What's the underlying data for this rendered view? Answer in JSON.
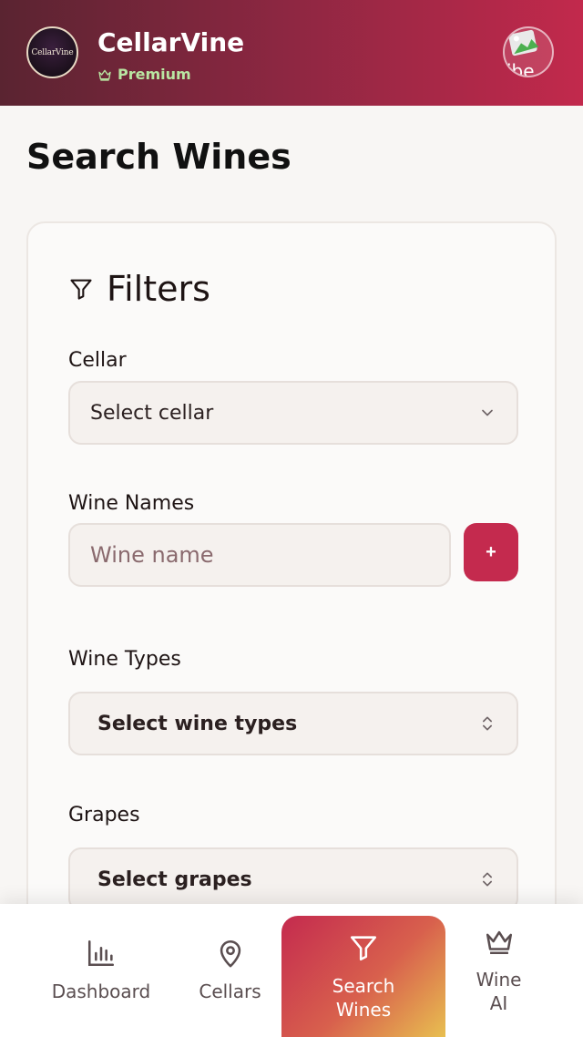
{
  "header": {
    "app_name": "CellarVine",
    "logo_text": "CellarVine",
    "plan_badge": "Premium",
    "avatar_alt": "ibe"
  },
  "page": {
    "title": "Search Wines"
  },
  "filters": {
    "title": "Filters",
    "cellar": {
      "label": "Cellar",
      "value": "Select cellar"
    },
    "wine_names": {
      "label": "Wine Names",
      "placeholder": "Wine name",
      "add_label": "+"
    },
    "wine_types": {
      "label": "Wine Types",
      "value": "Select wine types"
    },
    "grapes": {
      "label": "Grapes",
      "value": "Select grapes"
    }
  },
  "bottom_nav": {
    "items": [
      {
        "label": "Dashboard",
        "icon": "bar-chart-icon",
        "active": false
      },
      {
        "label": "Cellars",
        "icon": "map-pin-icon",
        "active": false
      },
      {
        "label": "Search Wines",
        "icon": "filter-icon",
        "active": true
      },
      {
        "label": "Wine AI",
        "icon": "crown-icon",
        "active": false
      }
    ]
  },
  "colors": {
    "brand_primary": "#c42a4e",
    "header_start": "#5a2431",
    "header_end": "#c2294c",
    "premium_green": "#b9e6a2",
    "active_gradient_end": "#e8bf50"
  }
}
